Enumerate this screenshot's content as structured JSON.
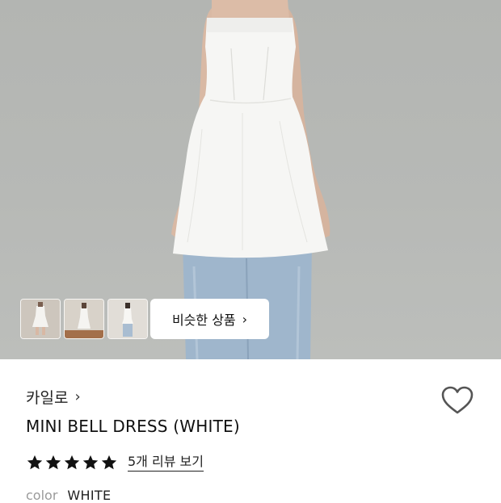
{
  "product": {
    "brand": "카일로",
    "title": "MINI BELL DRESS (WHITE)",
    "rating": 5,
    "rating_max": 5,
    "review_link": "5개 리뷰 보기",
    "color_label": "color",
    "color_value": "WHITE"
  },
  "gallery": {
    "similar_button": "비슷한 상품",
    "thumbnail_count": 3
  },
  "icons": {
    "brand_chevron": "chevron-right-icon",
    "similar_chevron": "chevron-right-icon",
    "wishlist": "heart-outline-icon",
    "star": "star-filled-icon"
  },
  "colors": {
    "background": "#ffffff",
    "photo_backdrop": "#b6b8b5",
    "text": "#111111",
    "muted": "#9a9a9a"
  }
}
